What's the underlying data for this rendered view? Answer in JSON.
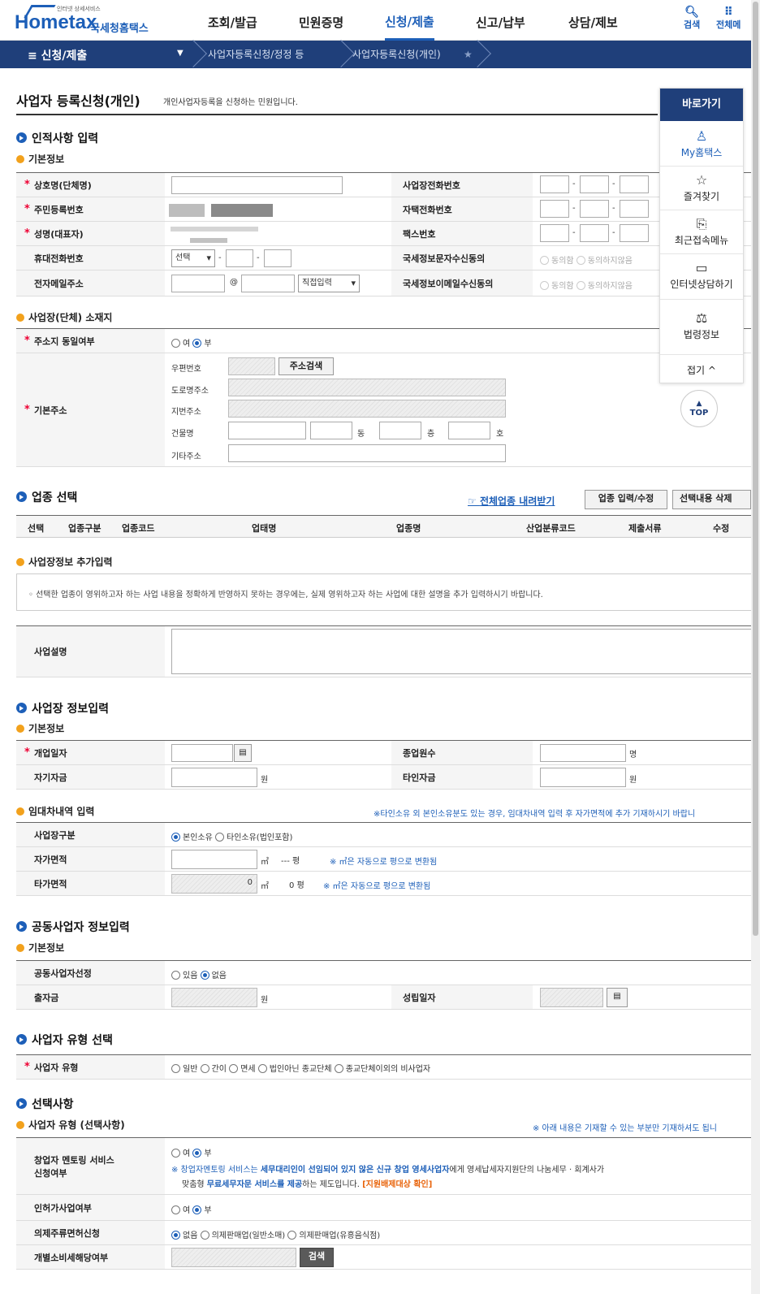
{
  "header": {
    "logo_small": "인터넷 상세서비스",
    "logo_main": "Hometax",
    "logo_kr": "국세청홈택스",
    "nav": [
      "조회/발급",
      "민원증명",
      "신청/제출",
      "신고/납부",
      "상담/제보"
    ],
    "active_nav": "신청/제출",
    "search_label": "검색",
    "all_label": "전체메"
  },
  "locbar": {
    "menu": "≡ 신청/제출",
    "crumbs": [
      "사업자등록신청/정정 등",
      "사업자등록신청(개인)"
    ]
  },
  "page": {
    "title": "사업자 등록신청(개인)",
    "desc": "개인사업자등록을 신청하는 민원입니다."
  },
  "sec1": {
    "title": "인적사항 입력",
    "sub": "기본정보",
    "labels_left": [
      "상호명(단체명)",
      "주민등록번호",
      "성명(대표자)",
      "휴대전화번호",
      "전자메일주소"
    ],
    "labels_right": [
      "사업장전화번호",
      "자택전화번호",
      "팩스번호",
      "국세정보문자수신동의",
      "국세정보이메일수신동의"
    ],
    "phone_select": "선택",
    "email_at": "@",
    "email_select": "직접입력",
    "agree": "동의함",
    "disagree": "동의하지않음"
  },
  "sec_addr": {
    "sub": "사업장(단체) 소재지",
    "same_label": "주소지 동일여부",
    "yes": "여",
    "no": "부",
    "basic_label": "기본주소",
    "postal": "우편번호",
    "search_btn": "주소검색",
    "road": "도로명주소",
    "jibun": "지번주소",
    "building": "건물명",
    "dong": "동",
    "floor": "층",
    "ho": "호",
    "etc": "기타주소"
  },
  "sec_biz": {
    "title": "업종 선택",
    "download": "전체업종 내려받기",
    "btn_edit": "업종 입력/수정",
    "btn_del": "선택내용 삭제",
    "columns": [
      "선택",
      "업종구분",
      "업종코드",
      "업태명",
      "업종명",
      "산업분류코드",
      "제출서류",
      "수정"
    ]
  },
  "sec_extra": {
    "sub": "사업장정보 추가입력",
    "notice": "선택한 업종이 영위하고자 하는 사업 내용을 정확하게 반영하지 못하는 경우에는, 실제 영위하고자 하는 사업에 대한 설명을 추가 입력하시기 바랍니다.",
    "desc_label": "사업설명"
  },
  "sec2": {
    "title": "사업장 정보입력",
    "sub": "기본정보",
    "open_date": "개업일자",
    "employees": "종업원수",
    "emp_unit": "명",
    "own_fund": "자기자금",
    "other_fund": "타인자금",
    "won": "원"
  },
  "sec_lease": {
    "sub": "임대차내역 입력",
    "note": "※타인소유 외 본인소유분도 있는 경우, 임대차내역 입력 후 자가면적에 추가 기재하시기 바랍니",
    "type_label": "사업장구분",
    "own": "본인소유",
    "other": "타인소유(법인포함)",
    "own_area": "자가면적",
    "other_area": "타가면적",
    "m2": "㎡",
    "pyeong_dash": "--- 평",
    "pyeong": "평",
    "area_note": "※ ㎡은 자동으로 평으로 변환됨",
    "other_area_value": "0",
    "other_pyeong_value": "0"
  },
  "sec3": {
    "title": "공동사업자 정보입력",
    "sub": "기본정보",
    "select_label": "공동사업자선정",
    "have": "있음",
    "none": "없음",
    "invest": "출자금",
    "won": "원",
    "est_date": "성립일자"
  },
  "sec4": {
    "title": "사업자 유형 선택",
    "label": "사업자 유형",
    "options": [
      "일반",
      "간이",
      "면세",
      "법인아닌 종교단체",
      "종교단체이외의 비사업자"
    ]
  },
  "sec5": {
    "title": "선택사항",
    "sub": "사업자 유형 (선택사항)",
    "note": "※ 아래 내용은 기재할 수 있는 부분만 기재하셔도 됩니",
    "mentor_label1": "창업자 멘토링 서비스",
    "mentor_label2": "신청여부",
    "yes": "여",
    "no": "부",
    "mentor_text1a": "※ 창업자멘토링 서비스는 ",
    "mentor_text1b": "세무대리인이 선임되어 있지 않은 신규 창업 영세사업자",
    "mentor_text1c": "에게 영세납세자지원단의 나눔세무 · 회계사가",
    "mentor_text2a": "맞춤형 ",
    "mentor_text2b": "무료세무자문 서비스를 제공",
    "mentor_text2c": "하는 제도입니다. ",
    "mentor_text2d": "[지원배제대상 확인]",
    "permit_label": "인허가사업여부",
    "liquor_label": "의제주류면허신청",
    "liquor_opts": [
      "없음",
      "의제판매업(일반소매)",
      "의제판매업(유흥음식점)"
    ],
    "excise_label": "개별소비세해당여부",
    "search_btn": "검색"
  },
  "quick": {
    "title": "바로가기",
    "items": [
      "My홈택스",
      "즐겨찾기",
      "최근접속메뉴",
      "인터넷상담하기",
      "법령정보"
    ],
    "fold": "접기 ^",
    "top": "TOP"
  }
}
